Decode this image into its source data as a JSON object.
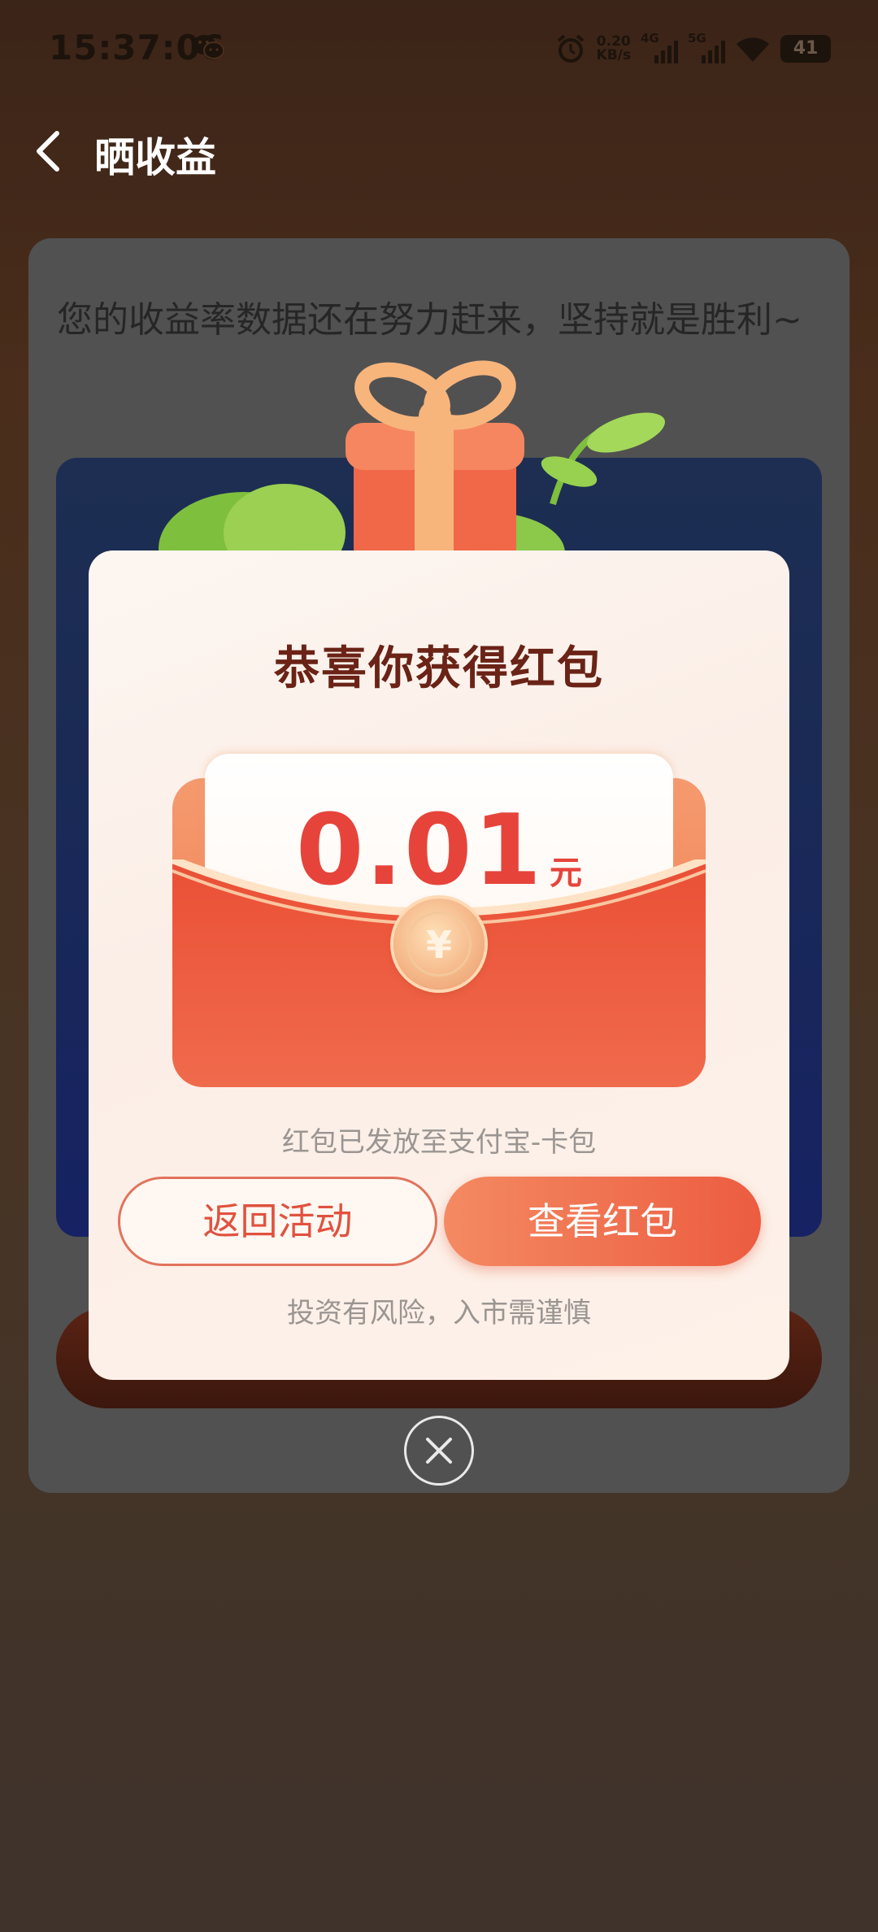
{
  "status_bar": {
    "time": "15:37:06",
    "net_speed_value": "0.20",
    "net_speed_unit": "KB/s",
    "signal_1": "4G",
    "signal_2": "5G",
    "battery": "41"
  },
  "header": {
    "title": "晒收益"
  },
  "background": {
    "message": "您的收益率数据还在努力赶来，坚持就是胜利~"
  },
  "modal": {
    "title": "恭喜你获得红包",
    "amount": "0.01",
    "amount_unit": "元",
    "coin_symbol": "¥",
    "sent_tip": "红包已发放至支付宝-卡包",
    "back_button": "返回活动",
    "view_button": "查看红包",
    "risk_notice": "投资有风险，入市需谨慎"
  },
  "colors": {
    "accent_red": "#e6443a",
    "title_brown": "#6a2316",
    "button_gradient_start": "#f48a62",
    "button_gradient_end": "#ec5c40"
  }
}
